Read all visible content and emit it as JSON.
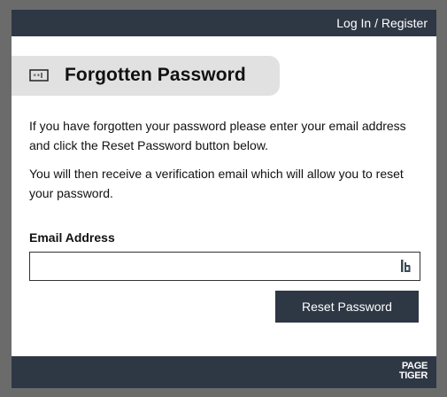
{
  "header": {
    "login_label": "Log In / Register"
  },
  "page": {
    "title": "Forgotten Password",
    "title_icon": "password-icon",
    "instructions_1": "If you have forgotten your password please enter your email address and click the Reset Password button below.",
    "instructions_2": "You will then receive a verification email which will allow you to reset your password."
  },
  "form": {
    "email_label": "Email Address",
    "email_value": "",
    "email_placeholder": "",
    "email_field_icon": "password-manager-icon",
    "reset_button_label": "Reset Password"
  },
  "footer": {
    "logo_line_1": "PAGE",
    "logo_line_2": "TIGER"
  },
  "colors": {
    "background": "#6b6b6b",
    "bar": "#2e3744",
    "title_pill": "#e1e1e1",
    "button": "#2e3744"
  }
}
